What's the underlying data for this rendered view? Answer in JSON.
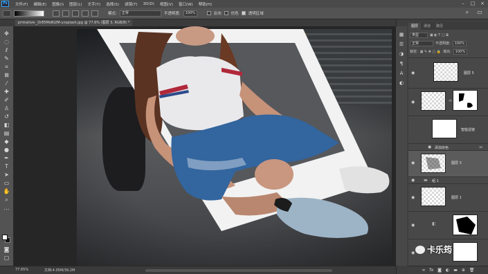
{
  "app": {
    "logo": "Ps"
  },
  "menu": [
    "文件(F)",
    "编辑(E)",
    "图像(I)",
    "图层(L)",
    "文字(Y)",
    "选择(S)",
    "滤镜(T)",
    "3D(D)",
    "视图(V)",
    "窗口(W)",
    "帮助(H)"
  ],
  "options": {
    "mode_label": "模式:",
    "mode_value": "正常",
    "opacity_label": "不透明度:",
    "opacity_value": "100%",
    "reverse_label": "反向",
    "dither_label": "仿色",
    "transparency_label": "透明区域",
    "transparency_checked": true
  },
  "document": {
    "tab_title": "primative-_Dr85MoNi2M-unsplash.jpg @ 77.6% (图层 3, RGB/8) *"
  },
  "status": {
    "zoom": "77.65%",
    "doc_info": "文档:4.05M/39.2M"
  },
  "layers_panel": {
    "tabs": [
      "图层",
      "通道",
      "路径"
    ],
    "active_tab": "图层",
    "kind_filter": "类型",
    "blend_mode": "正常",
    "opacity_label": "不透明度:",
    "opacity_value": "100%",
    "lock_label": "锁定:",
    "fill_label": "填充:",
    "fill_value": "100%",
    "layers": [
      {
        "name": "图层 5",
        "kind": "pixel",
        "visible": true
      },
      {
        "name": "",
        "kind": "masked-pixel",
        "visible": true
      },
      {
        "name": "智能滤镜",
        "kind": "smart-filter",
        "visible": true
      },
      {
        "name": "添加杂色",
        "kind": "filter-entry",
        "visible": true
      },
      {
        "name": "图层 3",
        "kind": "pixel",
        "visible": true,
        "selected": true
      },
      {
        "name": "组 1",
        "kind": "group",
        "visible": true
      },
      {
        "name": "图层 1",
        "kind": "pixel",
        "visible": true
      },
      {
        "name": "",
        "kind": "masked",
        "visible": true
      },
      {
        "name": "",
        "kind": "pixel-white",
        "visible": true
      }
    ]
  },
  "watermark": {
    "text": "卡乐筠"
  },
  "colors": {
    "accent": "#31a8ff",
    "ui_dark": "#3a3a3a",
    "ui_mid": "#535353"
  }
}
